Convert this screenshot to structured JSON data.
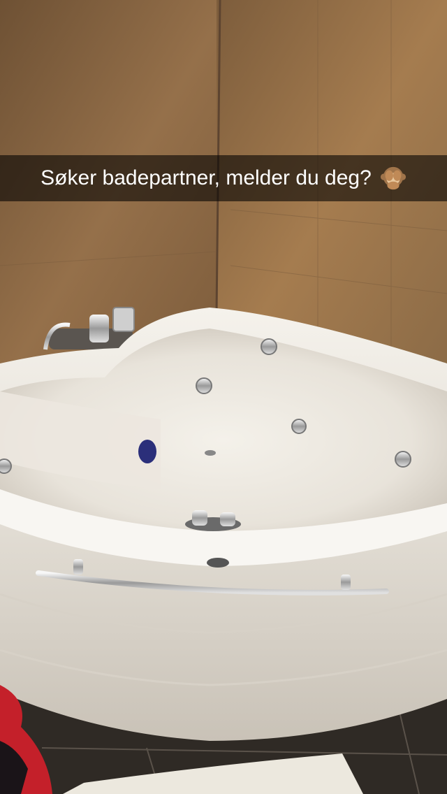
{
  "snap": {
    "caption": "Søker badepartner, melder du deg?",
    "emoji_icon": "see-no-evil-monkey-icon"
  },
  "scene": {
    "wall_color": "#a57c4f",
    "tub_color": "#f2efe9",
    "floor_color": "#2f2a25"
  }
}
